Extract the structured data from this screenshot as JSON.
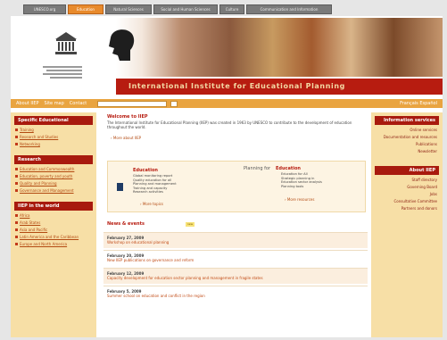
{
  "top_tabs": [
    {
      "label": "UNESCO.org",
      "active": false
    },
    {
      "label": "Education",
      "active": true
    },
    {
      "label": "Natural Sciences",
      "active": false
    },
    {
      "label": "Social and Human Sciences",
      "active": false
    },
    {
      "label": "Culture",
      "active": false
    },
    {
      "label": "Communication and Information",
      "active": false
    }
  ],
  "banner": {
    "title": "International Institute for Educational Planning"
  },
  "nav": {
    "links": [
      "About IIEP",
      "Site map",
      "Contact"
    ],
    "search_placeholder": "",
    "right_text": "Français  Español"
  },
  "left_sidebar": {
    "sections": [
      {
        "heading": "Specific Educational",
        "items": [
          "Training",
          "Research and Studies",
          "Networking"
        ]
      },
      {
        "heading": "Research",
        "items": [
          "Education and Commonwealth",
          "Education, poverty and youth",
          "Quality and Planning",
          "Governance and Management"
        ]
      },
      {
        "heading": "IIEP in the world",
        "items": [
          "Africa",
          "Arab States",
          "Asia and Pacific",
          "Latin America and the Caribbean",
          "Europe and North America"
        ]
      }
    ]
  },
  "right_sidebar": {
    "sections": [
      {
        "heading": "Information services",
        "items": [
          "Online services",
          "Documentation and resources",
          "Publications",
          "Newsletter"
        ]
      },
      {
        "heading": "About IIEP",
        "items": [
          "Staff directory",
          "Governing Board",
          "Jobs",
          "Consultative Committee",
          "Partners and donors"
        ]
      }
    ]
  },
  "main": {
    "welcome_title": "Welcome to IIEP",
    "welcome_text": "The International Institute for Educational Planning (IIEP) was created in 1963 by UNESCO to contribute to the development of education throughout the world.",
    "welcome_more": "› More about IIEP",
    "feature": {
      "left_heading": "Education",
      "left_lines": [
        "Global monitoring report",
        "Quality education for all",
        "Planning and management",
        "Training and capacity",
        "Research activities"
      ],
      "left_more": "› More topics",
      "right_heading": "Planning for",
      "right_heading_accent": "Education",
      "right_lines": [
        "Education for All",
        "Strategic planning in",
        "Education sector analysis",
        "Planning tools"
      ],
      "right_more": "› More resources"
    },
    "news_heading": "News & events",
    "news_badge": "new",
    "news": [
      {
        "date": "February 27, 2009",
        "link": "Workshop on educational planning"
      },
      {
        "date": "February 20, 2009",
        "link": "New IIEP publications on governance and reform"
      },
      {
        "date": "February 12, 2009",
        "link": "Capacity development for education sector planning and management in fragile states"
      },
      {
        "date": "February 5, 2009",
        "link": "Summer school on education and conflict in the region"
      }
    ]
  }
}
